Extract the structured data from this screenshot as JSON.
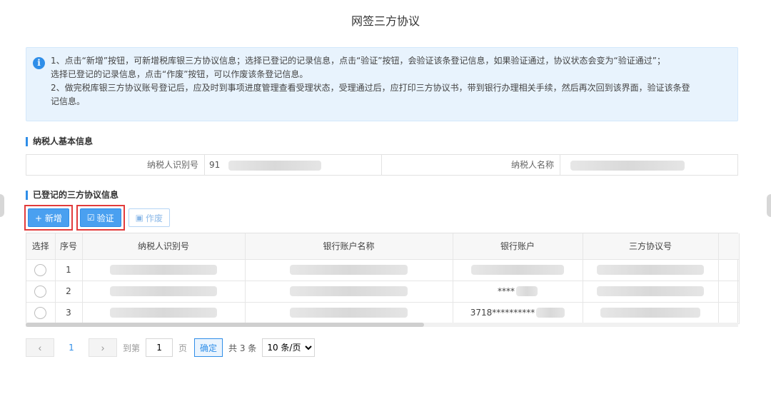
{
  "page": {
    "title": "网签三方协议"
  },
  "notice": {
    "line1": "1、点击“新增”按钮，可新增税库银三方协议信息；选择已登记的记录信息，点击“验证”按钮，会验证该条登记信息，如果验证通过，协议状态会变为“验证通过”；",
    "line2": "选择已登记的记录信息，点击“作废”按钮，可以作废该条登记信息。",
    "line3": "2、做完税库银三方协议账号登记后，应及时到事项进度管理查看受理状态，受理通过后，应打印三方协议书，带到银行办理相关手续，然后再次回到该界面，验证该条登",
    "line4": "记信息。"
  },
  "basic_info": {
    "section_title": "纳税人基本信息",
    "tax_id_label": "纳税人识别号",
    "tax_id_value": "91",
    "name_label": "纳税人名称",
    "name_value": ""
  },
  "records": {
    "section_title": "已登记的三方协议信息",
    "add_label": "+ 新增",
    "verify_label": "验证",
    "void_label": "作废",
    "columns": [
      "选择",
      "序号",
      "纳税人识别号",
      "银行账户名称",
      "银行账户",
      "三方协议号"
    ],
    "rows": [
      {
        "seq": "1",
        "account": ""
      },
      {
        "seq": "2",
        "account": "****"
      },
      {
        "seq": "3",
        "account": "3718**********"
      }
    ]
  },
  "pager": {
    "prev": "‹",
    "next": "›",
    "current": "1",
    "goto_label": "到第",
    "page_input": "1",
    "page_unit": "页",
    "confirm": "确定",
    "total": "共 3 条",
    "page_size": "10 条/页"
  }
}
